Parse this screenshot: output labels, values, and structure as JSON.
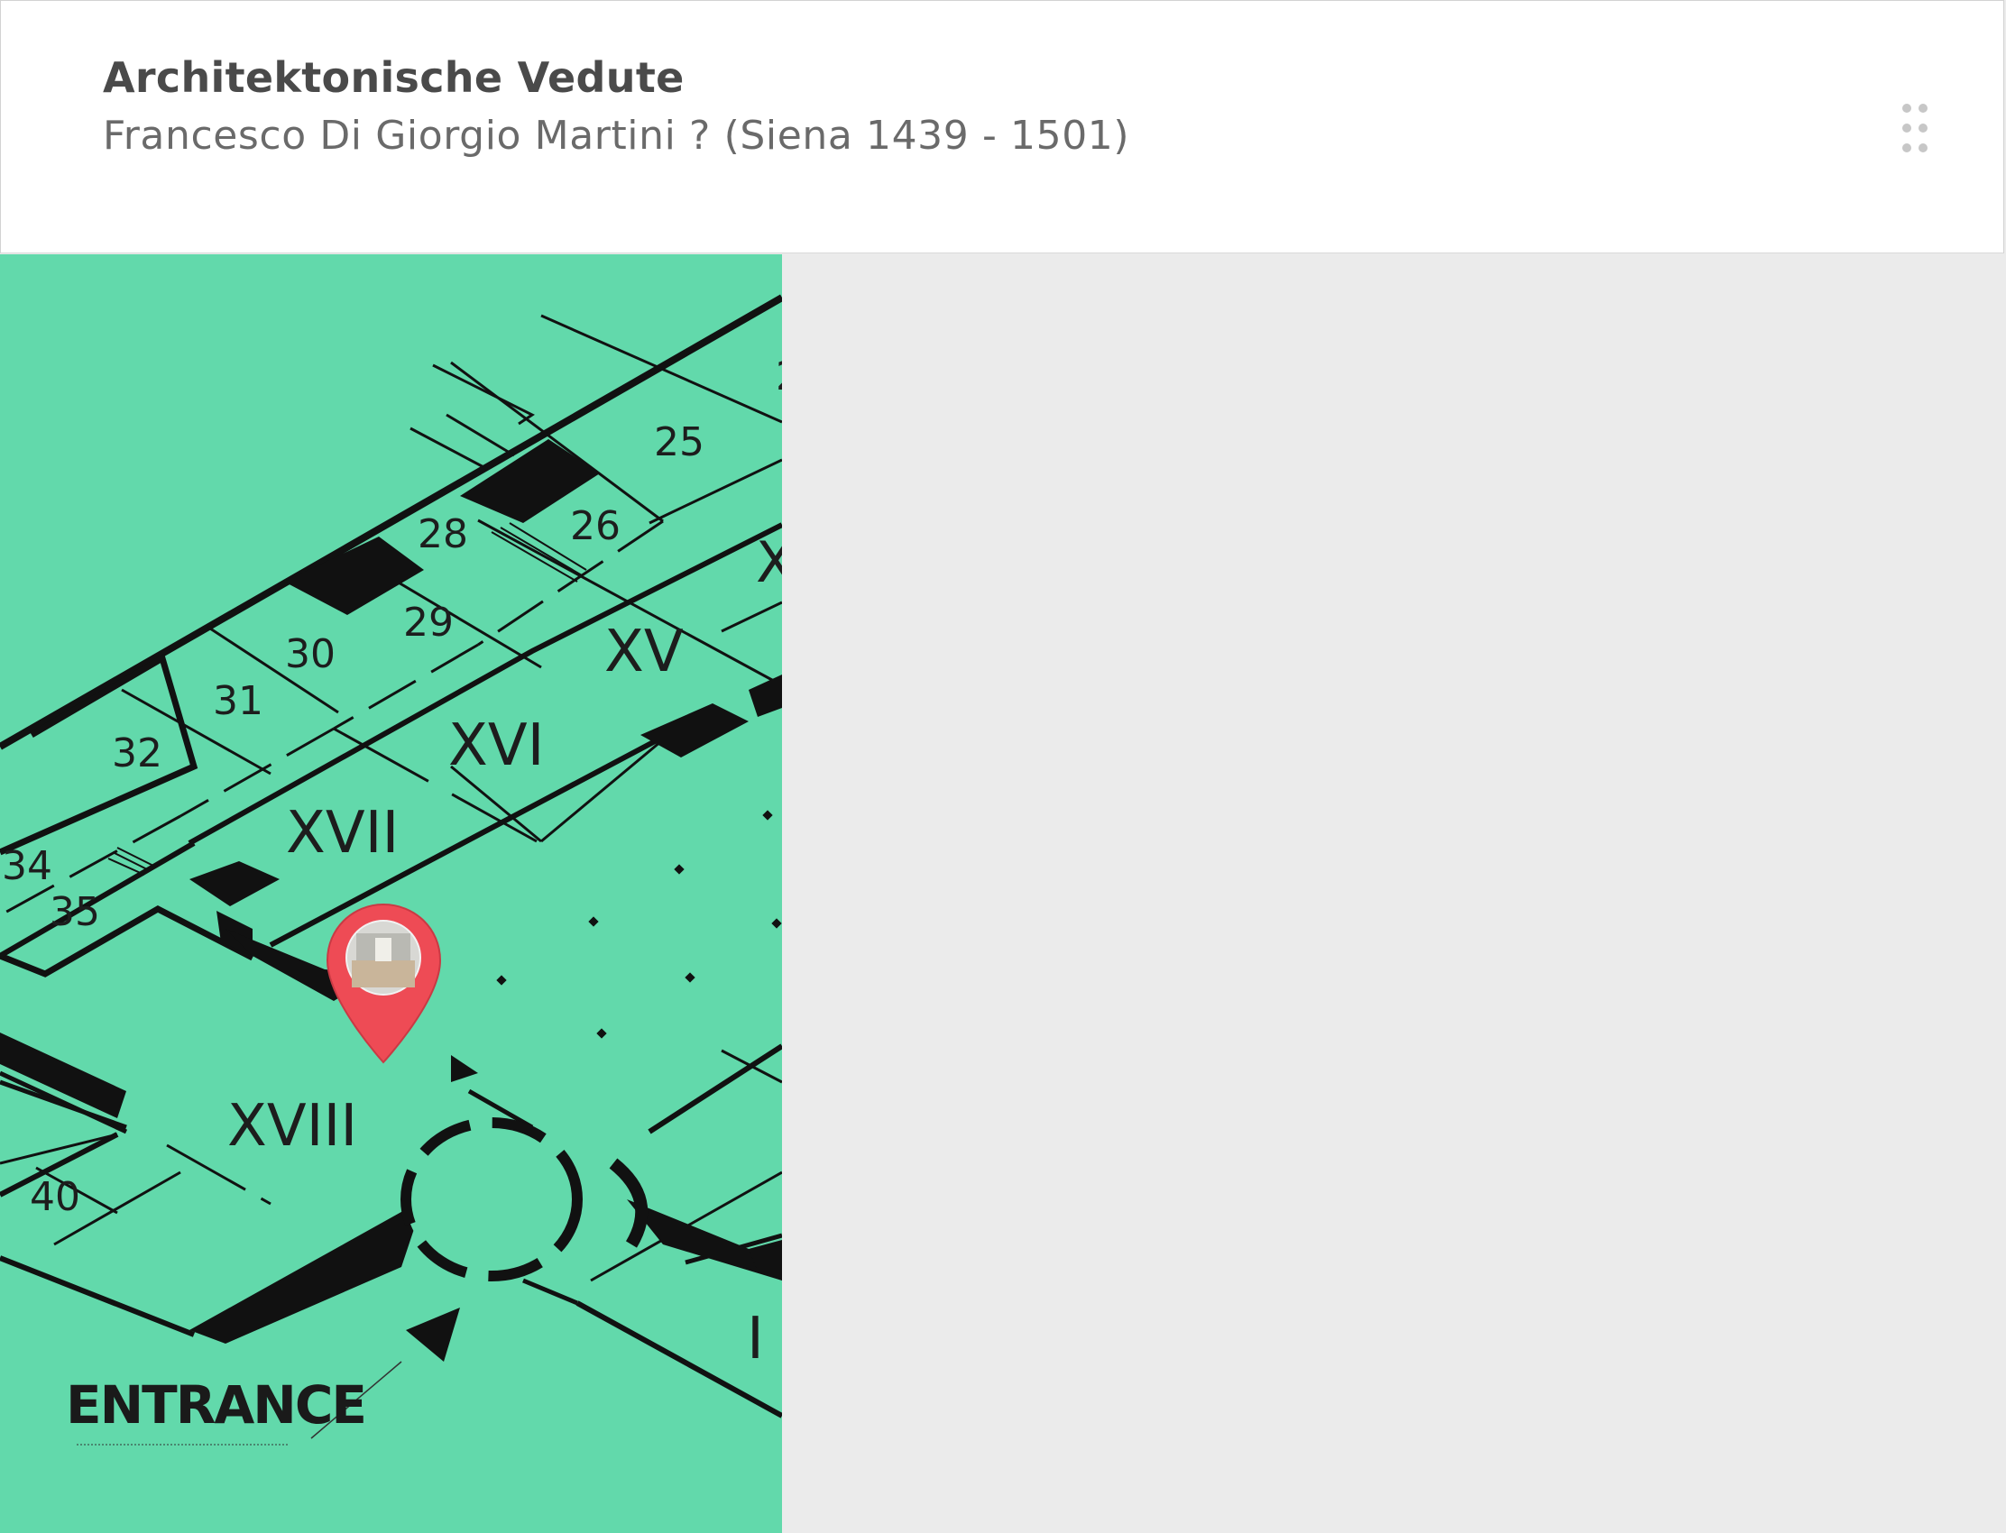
{
  "artwork": {
    "title": "Architektonische Vedute",
    "attribution": "Francesco Di Giorgio Martini ? (Siena 1439 - 1501)"
  },
  "map": {
    "entrance_label": "ENTRANCE",
    "rooms": {
      "r24": "2",
      "r25": "25",
      "r26": "26",
      "r28": "28",
      "r29": "29",
      "r30": "30",
      "r31": "31",
      "r32": "32",
      "r34": "34",
      "r35": "35",
      "r40": "40",
      "rXIV": "X",
      "rXV": "XV",
      "rXVI": "XVI",
      "rXVII": "XVII",
      "rXVIII": "XVIII",
      "rI": "I"
    },
    "colors": {
      "floor": "#62d9ab",
      "walls": "#111111",
      "pin": "#ee4b55",
      "panel": "#ebebeb"
    },
    "marker_icon": "map-pin-icon"
  }
}
